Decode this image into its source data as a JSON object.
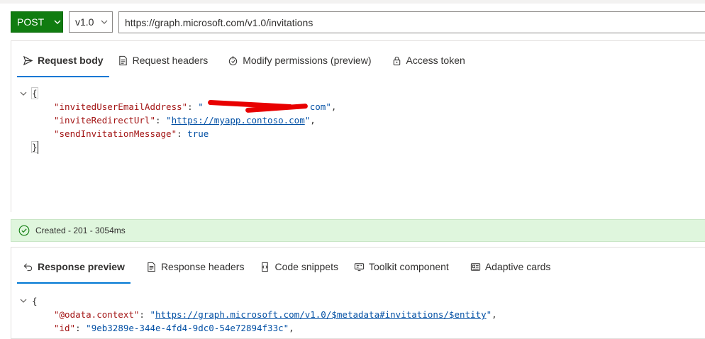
{
  "query": {
    "method": "POST",
    "version": "v1.0",
    "url": "https://graph.microsoft.com/v1.0/invitations"
  },
  "request_tabs": [
    {
      "label": "Request body",
      "icon": "send-icon",
      "active": true
    },
    {
      "label": "Request headers",
      "icon": "document-icon",
      "active": false
    },
    {
      "label": "Modify permissions (preview)",
      "icon": "permission-icon",
      "active": false
    },
    {
      "label": "Access token",
      "icon": "lock-icon",
      "active": false
    }
  ],
  "request_body": {
    "open_brace": "{",
    "close_brace": "}",
    "lines": [
      {
        "key": "\"invitedUserEmailAddress\"",
        "sep": ": ",
        "value": "\"",
        "value_tail": "com\"",
        "trail": ","
      },
      {
        "key": "\"inviteRedirectUrl\"",
        "sep": ": ",
        "quote_open": "\"",
        "value": "https://myapp.contoso.com",
        "quote_close": "\"",
        "trail": ","
      },
      {
        "key": "\"sendInvitationMessage\"",
        "sep": ": ",
        "value": "true",
        "trail": ""
      }
    ]
  },
  "status": {
    "text": "Created - 201 - 3054ms",
    "icon": "check-circle-icon",
    "color": "#107c10"
  },
  "response_tabs": [
    {
      "label": "Response preview",
      "icon": "undo-arrow-icon",
      "active": true
    },
    {
      "label": "Response headers",
      "icon": "document-icon",
      "active": false
    },
    {
      "label": "Code snippets",
      "icon": "code-snippet-icon",
      "active": false
    },
    {
      "label": "Toolkit component",
      "icon": "toolkit-icon",
      "active": false
    },
    {
      "label": "Adaptive cards",
      "icon": "card-icon",
      "active": false
    }
  ],
  "response_body": {
    "open_brace": "{",
    "lines": [
      {
        "key": "\"@odata.context\"",
        "sep": ": ",
        "quote_open": "\"",
        "value": "https://graph.microsoft.com/v1.0/$metadata#invitations/$entity",
        "quote_close": "\"",
        "trail": ","
      },
      {
        "key": "\"id\"",
        "sep": ": ",
        "value": "\"9eb3289e-344e-4fd4-9dc0-54e72894f33c\"",
        "trail": ","
      }
    ]
  },
  "colors": {
    "accent": "#0078d4",
    "method_bg": "#107c10",
    "status_bg": "#dff6dd",
    "json_key": "#a31515",
    "json_value": "#0451a5",
    "redaction": "#e80000"
  }
}
